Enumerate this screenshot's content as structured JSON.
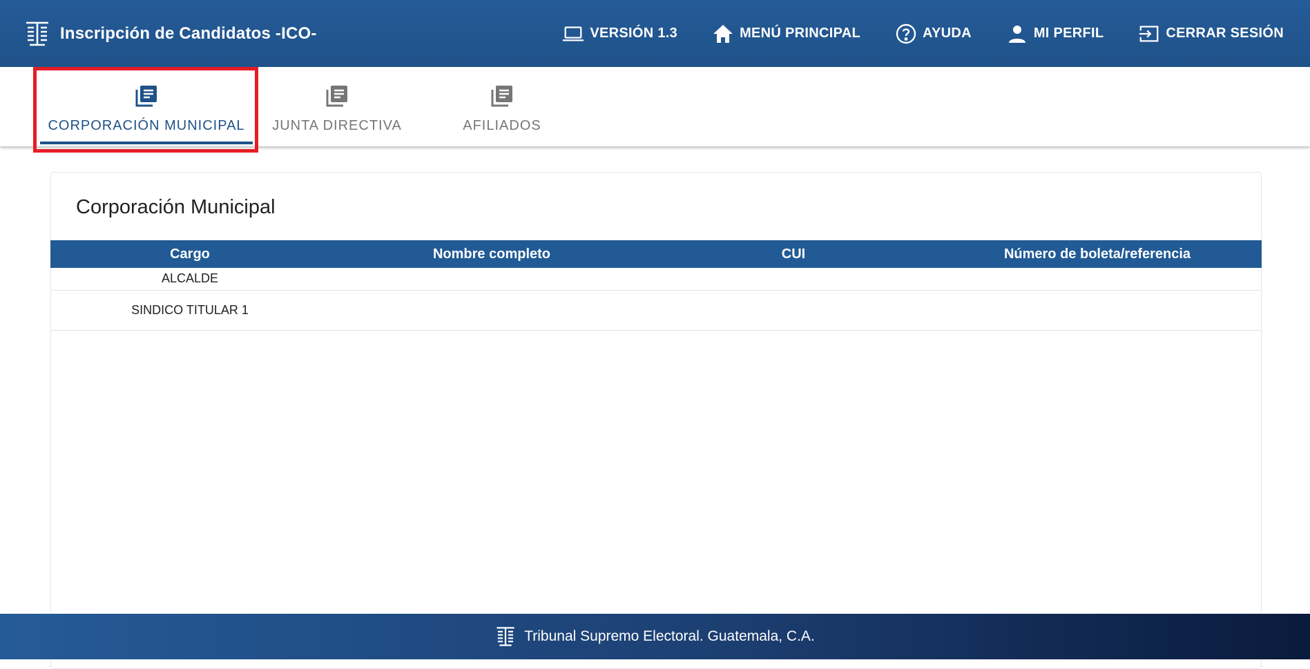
{
  "app": {
    "title": "Inscripción de Candidatos -ICO-",
    "logo_icon": "tse-logo-icon"
  },
  "nav": [
    {
      "icon": "laptop-icon",
      "label": "VERSIÓN 1.3"
    },
    {
      "icon": "home-icon",
      "label": "MENÚ PRINCIPAL"
    },
    {
      "icon": "help-circle-icon",
      "label": "AYUDA"
    },
    {
      "icon": "person-icon",
      "label": "MI PERFIL"
    },
    {
      "icon": "logout-icon",
      "label": "CERRAR SESIÓN"
    }
  ],
  "tabs": [
    {
      "icon": "library-books-icon",
      "label": "CORPORACIÓN MUNICIPAL",
      "active": true
    },
    {
      "icon": "library-books-icon",
      "label": "JUNTA DIRECTIVA",
      "active": false
    },
    {
      "icon": "library-books-icon",
      "label": "AFILIADOS",
      "active": false
    }
  ],
  "card": {
    "title": "Corporación Municipal"
  },
  "table": {
    "columns": [
      "Cargo",
      "Nombre completo",
      "CUI",
      "Número de boleta/referencia"
    ],
    "rows": [
      [
        "ALCALDE",
        "",
        "",
        ""
      ],
      [
        "SINDICO TITULAR 1",
        "",
        "",
        ""
      ]
    ]
  },
  "footer": {
    "text": "Tribunal Supremo Electoral. Guatemala, C.A."
  },
  "colors": {
    "primary": "#1f5289",
    "highlight": "#e41d27",
    "inactive_tab": "#767676"
  }
}
